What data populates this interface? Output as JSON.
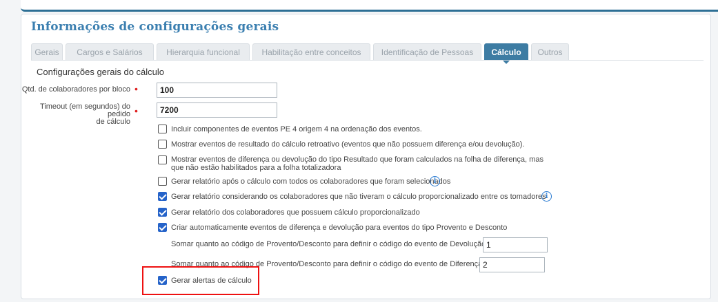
{
  "panel": {
    "title": "Informações de configurações gerais"
  },
  "tabs": [
    {
      "label": "Gerais"
    },
    {
      "label": "Cargos e Salários"
    },
    {
      "label": "Hierarquia funcional"
    },
    {
      "label": "Habilitação entre conceitos"
    },
    {
      "label": "Identificação de Pessoas"
    },
    {
      "label": "Cálculo",
      "active": true
    },
    {
      "label": "Outros"
    }
  ],
  "section": {
    "title": "Configurações gerais do cálculo"
  },
  "fields": {
    "qtd": {
      "label": "Qtd. de colaboradores por bloco",
      "value": "100"
    },
    "timeout": {
      "label_line1": "Timeout (em segundos) do pedido",
      "label_line2": "de cálculo",
      "value": "7200"
    },
    "required_mark": "•"
  },
  "options": [
    {
      "label": "Incluir componentes de eventos PE 4 origem 4 na ordenação dos eventos.",
      "checked": false
    },
    {
      "label": "Mostrar eventos de resultado do cálculo retroativo (eventos que não possuem diferença e/ou devolução).",
      "checked": false
    },
    {
      "label_line1": "Mostrar eventos de diferença ou devolução do tipo Resultado que foram calculados na folha de diferença, mas",
      "label_line2": "que não estão habilitados para a folha totalizadora",
      "checked": false
    },
    {
      "label": "Gerar relatório após o cálculo com todos os colaboradores que foram selecionados",
      "checked": false,
      "info": true
    },
    {
      "label": "Gerar relatório considerando os colaboradores que não tiveram o cálculo proporcionalizado entre os tomadores",
      "checked": true,
      "info": true
    },
    {
      "label": "Gerar relatório dos colaboradores que possuem cálculo proporcionalizado",
      "checked": true
    },
    {
      "label": "Criar automaticamente eventos de diferença e devolução para eventos do tipo Provento e Desconto",
      "checked": true
    },
    {
      "label": "Gerar alertas de cálculo",
      "checked": true
    }
  ],
  "sub_fields": {
    "devolucao": {
      "label": "Somar quanto ao código de Provento/Desconto para definir o código do evento de Devolução",
      "value": "1"
    },
    "diferenca": {
      "label": "Somar quanto ao código de Provento/Desconto para definir o código do evento de Diferença",
      "value": "2"
    }
  },
  "icons": {
    "info": "info-icon",
    "info_glyph": "i"
  },
  "colors": {
    "accent": "#3d7ca3",
    "title": "#3b7fb0",
    "checkbox": "#2563c9",
    "required": "#e02020",
    "highlight": "#e11111"
  }
}
